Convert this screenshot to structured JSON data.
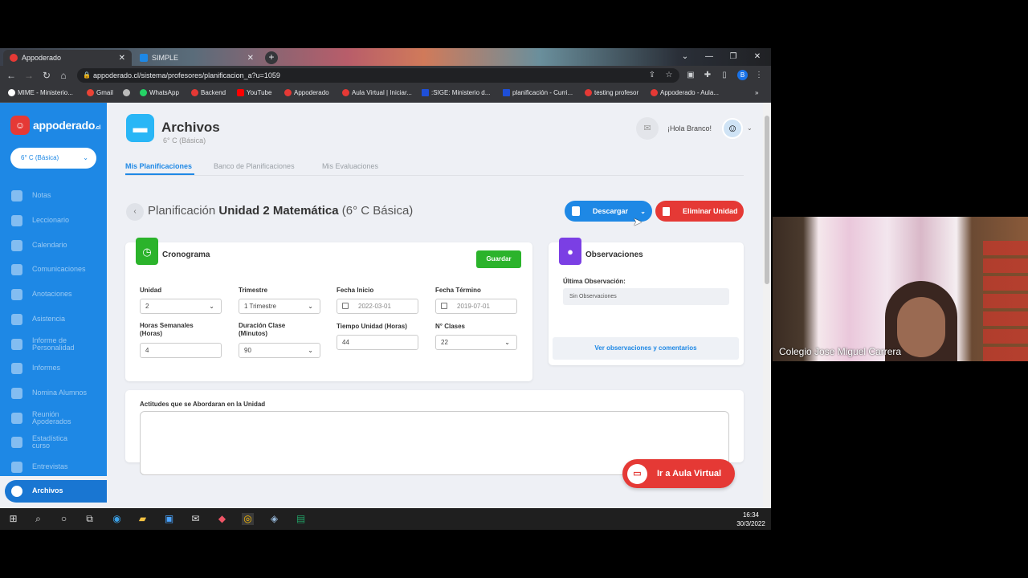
{
  "browser": {
    "tabs": [
      {
        "label": "Appoderado",
        "active": true
      },
      {
        "label": "SIMPLE",
        "active": false
      }
    ],
    "url": "appoderado.cl/sistema/profesores/planificacion_a?u=1059",
    "profile_initial": "B",
    "bookmarks": [
      "MIME - Ministerio...",
      "Gmail",
      "WhatsApp",
      "Backend",
      "YouTube",
      "Appoderado",
      "Aula Virtual | Iniciar...",
      ":SIGE: Ministerio d...",
      "planificación - Curri...",
      "testing profesor",
      "Appoderado - Aula..."
    ]
  },
  "sidebar": {
    "logo": "appoderado",
    "logo_suffix": ".cl",
    "course": "6° C (Básica)",
    "items": [
      {
        "label": "Notas",
        "icon": "star-icon"
      },
      {
        "label": "Leccionario",
        "icon": "document-icon"
      },
      {
        "label": "Calendario",
        "icon": "calendar-icon"
      },
      {
        "label": "Comunicaciones",
        "icon": "chat-icon"
      },
      {
        "label": "Anotaciones",
        "icon": "edit-icon"
      },
      {
        "label": "Asistencia",
        "icon": "user-icon"
      },
      {
        "label": "Informe de Personalidad",
        "icon": "face-icon"
      },
      {
        "label": "Informes",
        "icon": "document-icon"
      },
      {
        "label": "Nomina Alumnos",
        "icon": "group-icon"
      },
      {
        "label": "Reunión Apoderados",
        "icon": "meeting-icon"
      },
      {
        "label": "Estadística curso",
        "icon": "stats-icon"
      },
      {
        "label": "Entrevistas",
        "icon": "document-icon"
      },
      {
        "label": "Archivos",
        "icon": "folder-icon",
        "active": true
      }
    ]
  },
  "header": {
    "title": "Archivos",
    "subtitle": "6° C (Básica)",
    "greeting": "¡Hola Branco!"
  },
  "page_tabs": [
    {
      "label": "Mis Planificaciones",
      "active": true
    },
    {
      "label": "Banco de Planificaciones",
      "active": false
    },
    {
      "label": "Mis Evaluaciones",
      "active": false
    }
  ],
  "plan": {
    "prefix": "Planificación",
    "name": "Unidad 2 Matemática",
    "course": "(6° C Básica)",
    "download_label": "Descargar",
    "delete_label": "Eliminar Unidad"
  },
  "cronograma": {
    "title": "Cronograma",
    "save_label": "Guardar",
    "fields": {
      "unidad": {
        "label": "Unidad",
        "value": "2"
      },
      "trimestre": {
        "label": "Trimestre",
        "value": "1 Trimestre"
      },
      "fecha_inicio": {
        "label": "Fecha Inicio",
        "value": "2022-03-01"
      },
      "fecha_termino": {
        "label": "Fecha Término",
        "value": "2019-07-01"
      },
      "horas_semanales": {
        "label": "Horas Semanales (Horas)",
        "value": "4"
      },
      "duracion_clase": {
        "label": "Duración Clase (Minutos)",
        "value": "90"
      },
      "tiempo_unidad": {
        "label": "Tiempo Unidad (Horas)",
        "value": "44"
      },
      "n_clases": {
        "label": "N° Clases",
        "value": "22"
      }
    }
  },
  "observaciones": {
    "title": "Observaciones",
    "last_label": "Última Observación:",
    "last_value": "Sin Observaciones",
    "link_label": "Ver observaciones y comentarios"
  },
  "actitudes": {
    "label": "Actitudes que se Abordaran en la Unidad",
    "value": ""
  },
  "aula_button": "Ir a Aula Virtual",
  "taskbar": {
    "time": "16:34",
    "date": "30/3/2022"
  },
  "webcam": {
    "label": "Colegio Jose Miguel Carrera"
  },
  "colors": {
    "primary": "#1e88e5",
    "danger": "#e53935",
    "success": "#2bb32b",
    "obs_badge": "#7b3fe4",
    "crono_badge": "#2bb32b"
  }
}
